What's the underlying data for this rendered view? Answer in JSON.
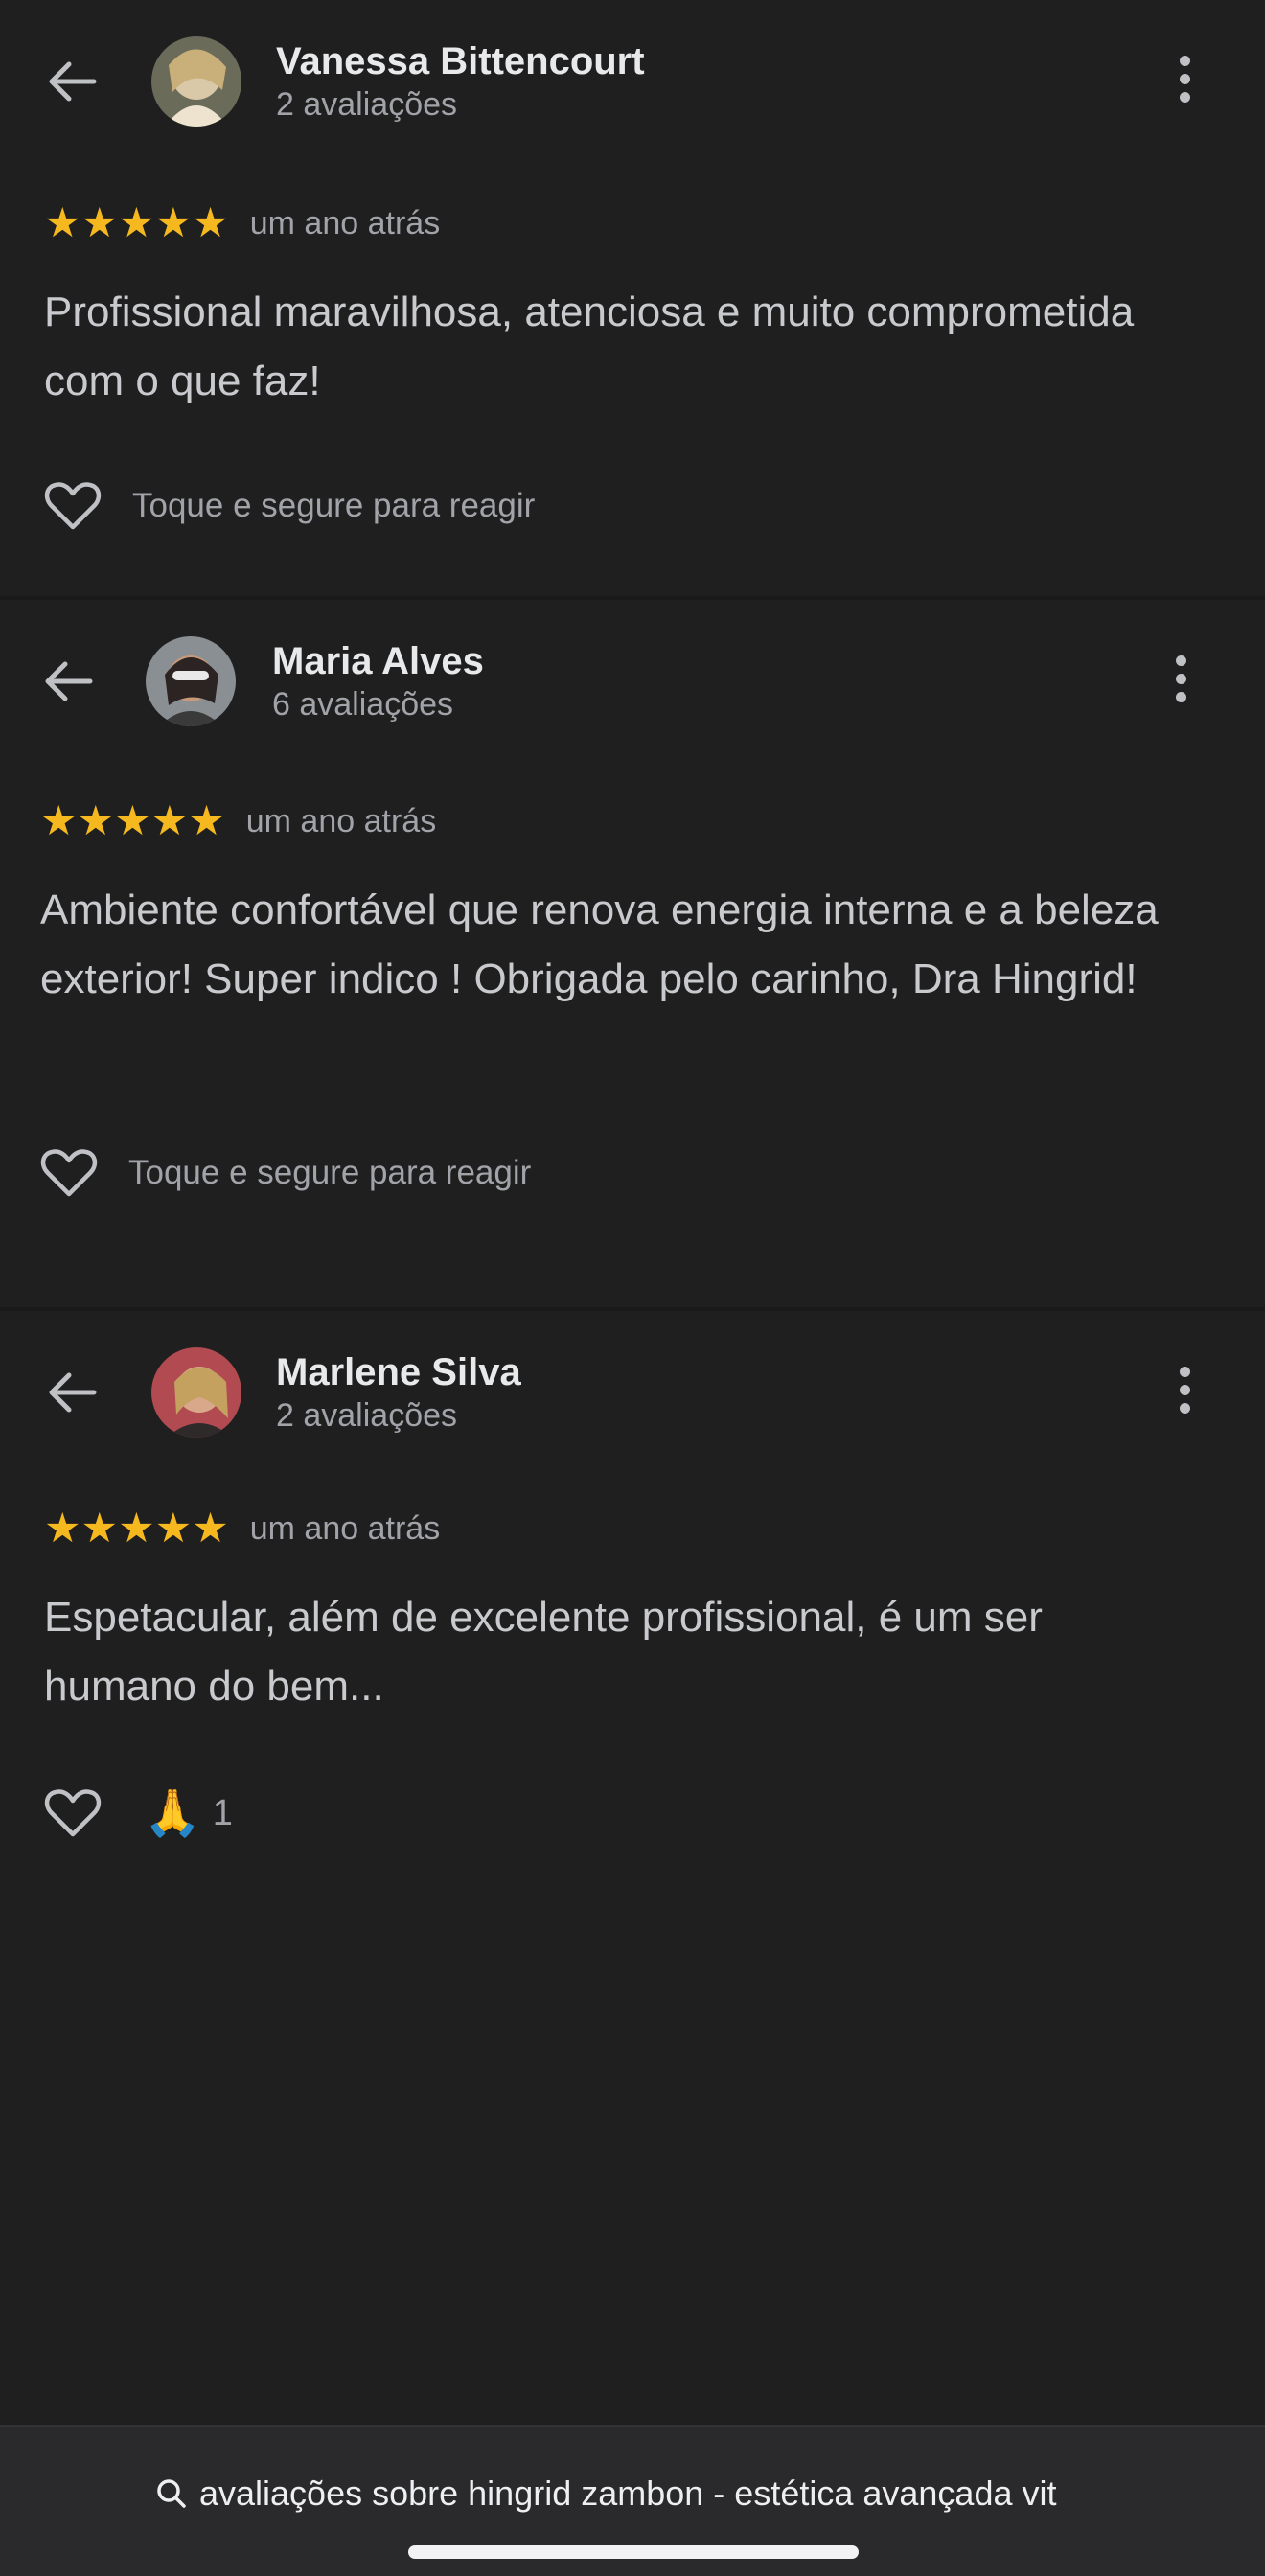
{
  "reviews": [
    {
      "author": "Vanessa Bittencourt",
      "review_count": "2 avaliações",
      "stars": "★★★★★",
      "date": "um ano atrás",
      "text": "Profissional maravilhosa, atenciosa e muito comprometida com o que faz!",
      "reaction_hint": "Toque e segure para reagir"
    },
    {
      "author": "Maria Alves",
      "review_count": "6 avaliações",
      "stars": "★★★★★",
      "date": "um ano atrás",
      "text": "Ambiente confortável que renova energia interna e a beleza exterior! Super indico ! Obrigada pelo carinho, Dra Hingrid!",
      "reaction_hint": "Toque e segure para reagir"
    },
    {
      "author": "Marlene Silva",
      "review_count": "2 avaliações",
      "stars": "★★★★★",
      "date": "um ano atrás",
      "text": "Espetacular, além de excelente profissional, é um ser humano do bem...",
      "reaction_emoji": "🙏",
      "reaction_count": "1"
    }
  ],
  "bottom_bar": {
    "search_text": "avaliações sobre hingrid zambon - estética avançada vit"
  },
  "colors": {
    "background": "#1f1f20",
    "star": "#f5b81f",
    "primary_text": "#e8e9eb",
    "secondary_text": "#a1a3a8"
  },
  "icons": [
    "back-arrow-icon",
    "more-vert-icon",
    "heart-outline-icon",
    "search-icon"
  ]
}
